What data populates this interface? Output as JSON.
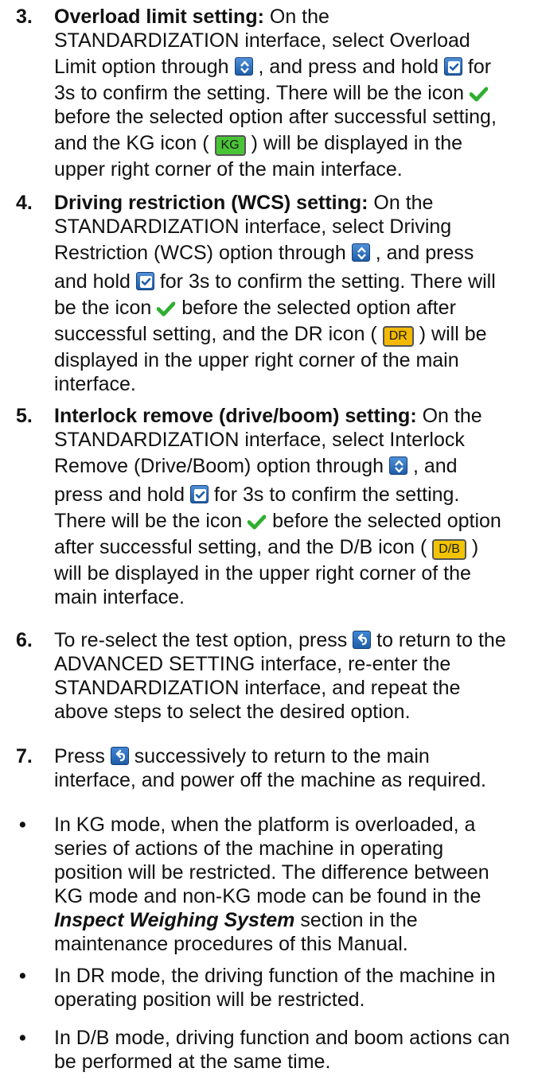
{
  "icons": {
    "nav": "up-down-arrow-icon",
    "confirm": "checkbox-confirm-icon",
    "check": "green-checkmark-icon",
    "back": "return-arrow-icon"
  },
  "badges": {
    "kg": "KG",
    "dr": "DR",
    "db": "D/B"
  },
  "colors": {
    "kg_badge": "#49c436",
    "dr_badge": "#f3b800",
    "db_badge": "#f1c300",
    "icon_blue": "#1e5ea8",
    "check_green": "#2fae2f"
  },
  "step3": {
    "num": "3.",
    "title": "Overload limit setting:",
    "t1": " On the",
    "l2": "STANDARDIZATION interface, select Overload",
    "l3a": "Limit option through ",
    "l3b": " , and press and hold ",
    "l3c": " for",
    "l4a": "3s to confirm the setting. There will be the icon ",
    "l5": "before the selected option after successful setting,",
    "l6a": "and the KG icon ( ",
    "l6b": " ) will be displayed in the",
    "l7": "upper right corner of the main interface."
  },
  "step4": {
    "num": "4.",
    "title": "Driving restriction (WCS) setting:",
    "t1": " On the",
    "l2": "STANDARDIZATION interface, select Driving",
    "l3a": "Restriction (WCS) option through ",
    "l3b": " , and press",
    "l4a": "and hold ",
    "l4b": " for 3s to confirm the setting. There will",
    "l5a": "be the icon ",
    "l5b": " before the selected option after",
    "l6a": "successful setting, and the DR icon ( ",
    "l6b": " ) will be",
    "l7": "displayed in the upper right corner of the main",
    "l8": "interface."
  },
  "step5": {
    "num": "5.",
    "title": "Interlock remove (drive/boom) setting:",
    "t1": " On the",
    "l2": "STANDARDIZATION interface, select Interlock",
    "l3a": "Remove (Drive/Boom) option through ",
    "l3b": " , and",
    "l4a": "press and hold ",
    "l4b": " for 3s to confirm the setting.",
    "l5a": "There will be the icon ",
    "l5b": " before the selected option",
    "l6a": "after successful setting, and the D/B icon ( ",
    "l6b": " )",
    "l7": "will be displayed in the upper right corner of the",
    "l8": "main interface."
  },
  "step6": {
    "num": "6.",
    "l1a": "To re-select the test option, press ",
    "l1b": " to return to the",
    "l2": "ADVANCED SETTING interface, re-enter the",
    "l3": "STANDARDIZATION interface, and repeat the",
    "l4": "above steps to select the desired option."
  },
  "step7": {
    "num": "7.",
    "l1a": "Press ",
    "l1b": " successively to return to the main",
    "l2": "interface, and power off the machine as required."
  },
  "notes": {
    "bullet": "•",
    "n1": {
      "l1": "In KG mode, when the platform is overloaded, a",
      "l2": "series of actions of the machine in operating",
      "l3": "position will be restricted. The difference between",
      "l4": "KG mode and non-KG mode can be found in the",
      "l5_emph": "Inspect Weighing System",
      "l5b": " section in the",
      "l6": "maintenance procedures of this Manual."
    },
    "n2": {
      "l1": "In DR mode, the driving function of the machine in",
      "l2": "operating position will be restricted."
    },
    "n3": {
      "l1": "In D/B mode, driving function and boom actions can",
      "l2": "be performed at the same time."
    }
  }
}
